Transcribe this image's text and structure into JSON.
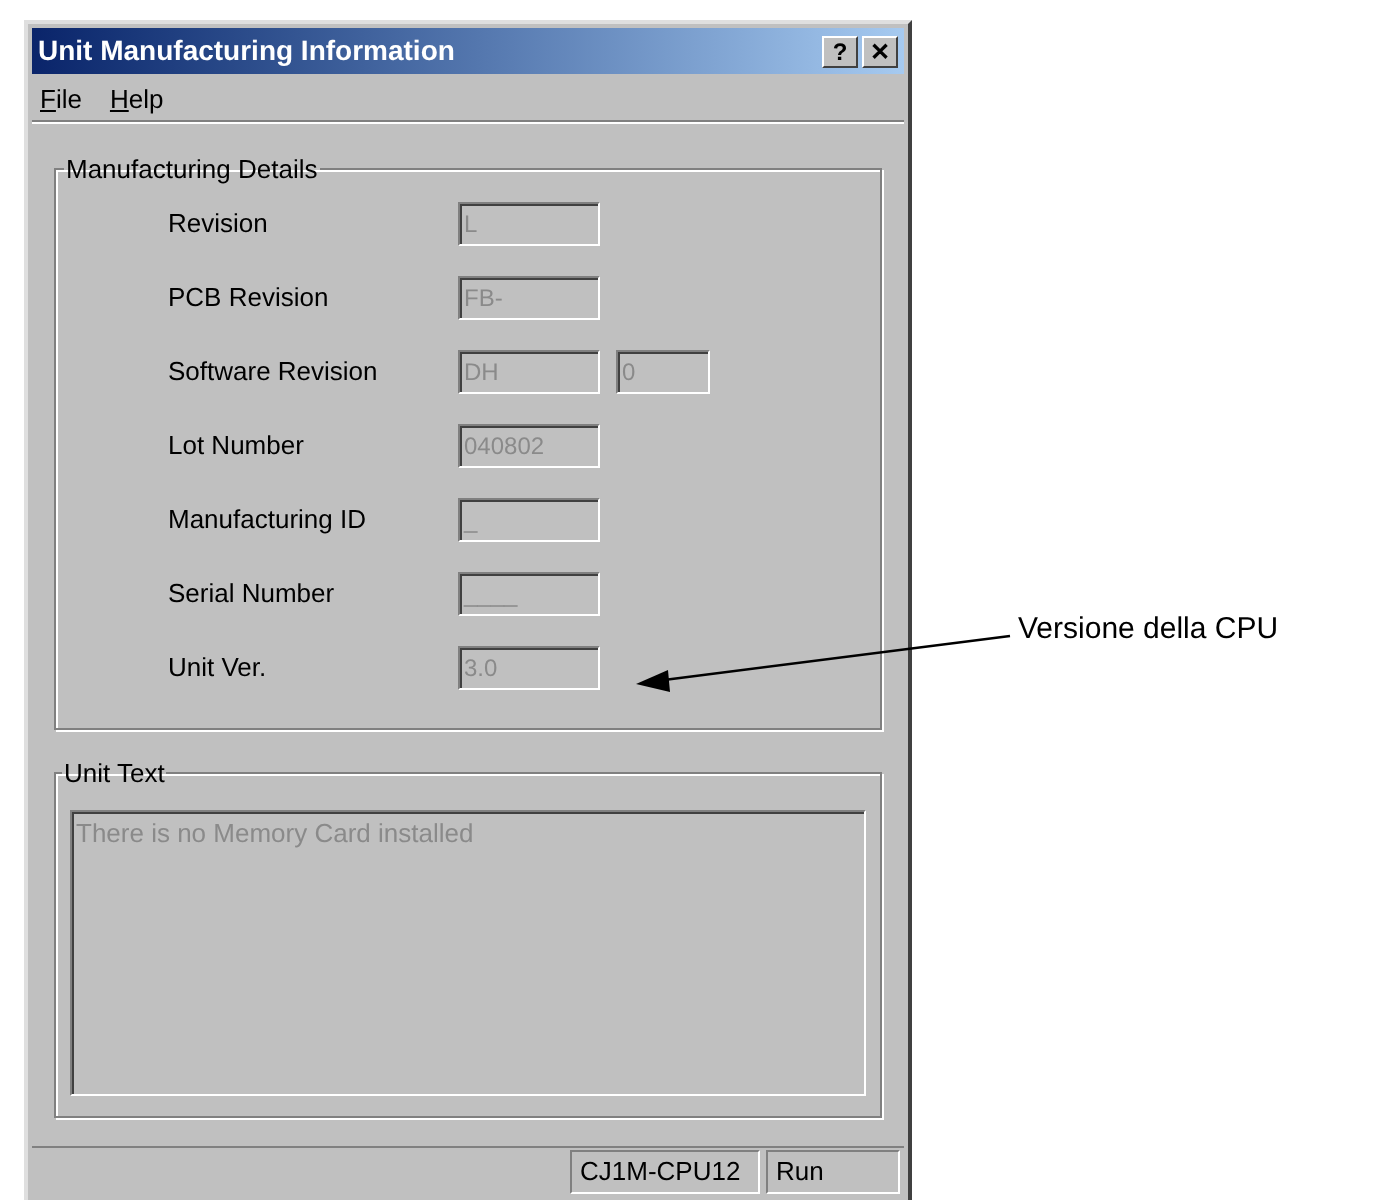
{
  "window": {
    "title": "Unit Manufacturing Information",
    "title_buttons": [
      "?",
      "✕"
    ]
  },
  "menu": [
    {
      "label": "File"
    },
    {
      "label": "Help"
    }
  ],
  "manufacturing_details": {
    "title": "Manufacturing Details",
    "rows": [
      {
        "label": "Revision",
        "values": [
          "L"
        ],
        "disabled": true
      },
      {
        "label": "PCB Revision",
        "values": [
          "FB-"
        ],
        "disabled": true
      },
      {
        "label": "Software Revision",
        "values": [
          "DH",
          "0"
        ],
        "disabled": true
      },
      {
        "label": "Lot Number",
        "values": [
          "040802"
        ],
        "disabled": true
      },
      {
        "label": "Manufacturing ID",
        "values": [
          "_"
        ],
        "disabled": true
      },
      {
        "label": "Serial Number",
        "values": [
          "____"
        ],
        "disabled": true
      },
      {
        "label": "Unit Ver.",
        "values": [
          "3.0"
        ],
        "disabled": true
      }
    ]
  },
  "unit_text": {
    "title": "Unit Text",
    "value": "There is no Memory Card installed",
    "disabled": true
  },
  "status_bar": [
    "CJ1M-CPU12",
    "Run"
  ],
  "annotation": {
    "label": "Versione della CPU"
  }
}
